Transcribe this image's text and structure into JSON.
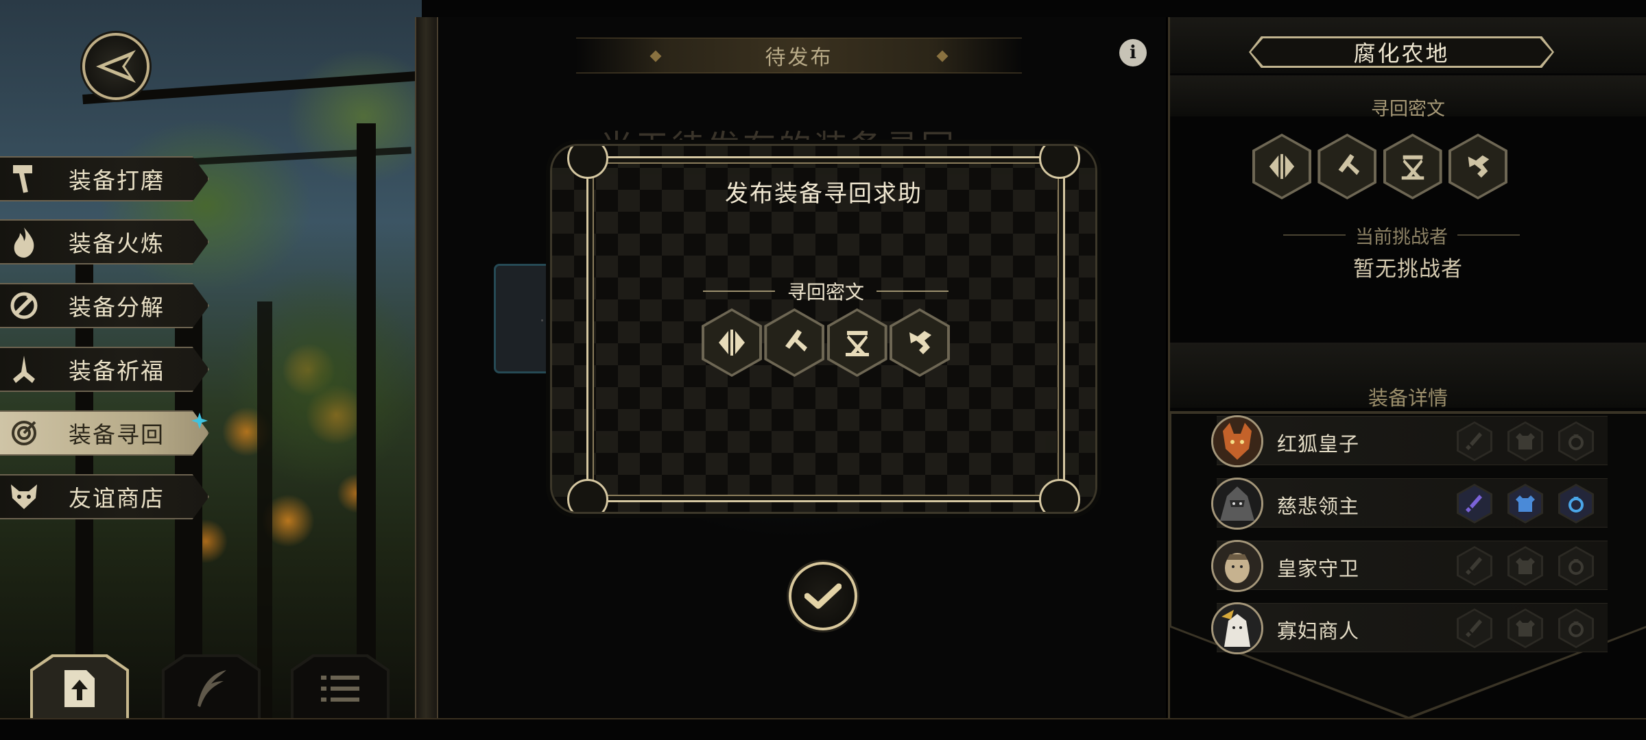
{
  "left_menu": {
    "items": [
      {
        "label": "装备打磨",
        "icon": "hammer-icon",
        "active": false
      },
      {
        "label": "装备火炼",
        "icon": "flame-icon",
        "active": false
      },
      {
        "label": "装备分解",
        "icon": "disassemble-icon",
        "active": false
      },
      {
        "label": "装备祈福",
        "icon": "praying-hands-icon",
        "active": false
      },
      {
        "label": "装备寻回",
        "icon": "target-icon",
        "active": true
      },
      {
        "label": "友谊商店",
        "icon": "fox-icon",
        "active": false
      }
    ]
  },
  "bottom_tabs": [
    {
      "icon": "upload-document-icon",
      "active": true
    },
    {
      "icon": "feather-icon",
      "active": false
    },
    {
      "icon": "list-icon",
      "active": false
    }
  ],
  "center": {
    "title": "待发布",
    "background_heading": "当天待发布的装备寻回"
  },
  "modal": {
    "title": "发布装备寻回求助",
    "cipher_label": "寻回密文",
    "runes": [
      "rune-1-icon",
      "rune-2-icon",
      "rune-3-icon",
      "rune-4-icon"
    ]
  },
  "right_panel": {
    "region_name": "腐化农地",
    "cipher_label": "寻回密文",
    "challenger_label": "当前挑战者",
    "challenger_value": "暂无挑战者",
    "equipment_label": "装备详情",
    "heroes": [
      {
        "name": "红狐皇子",
        "slots": [
          false,
          false,
          false
        ]
      },
      {
        "name": "慈悲领主",
        "slots": [
          true,
          true,
          true
        ]
      },
      {
        "name": "皇家守卫",
        "slots": [
          false,
          false,
          false
        ]
      },
      {
        "name": "寡妇商人",
        "slots": [
          false,
          false,
          false
        ]
      }
    ]
  },
  "colors": {
    "accent_gold": "#d6c8a2",
    "active_menu": "#c2b695",
    "equipped_slot": "#5e67c9",
    "notify_dot": "#3ec3e0"
  }
}
